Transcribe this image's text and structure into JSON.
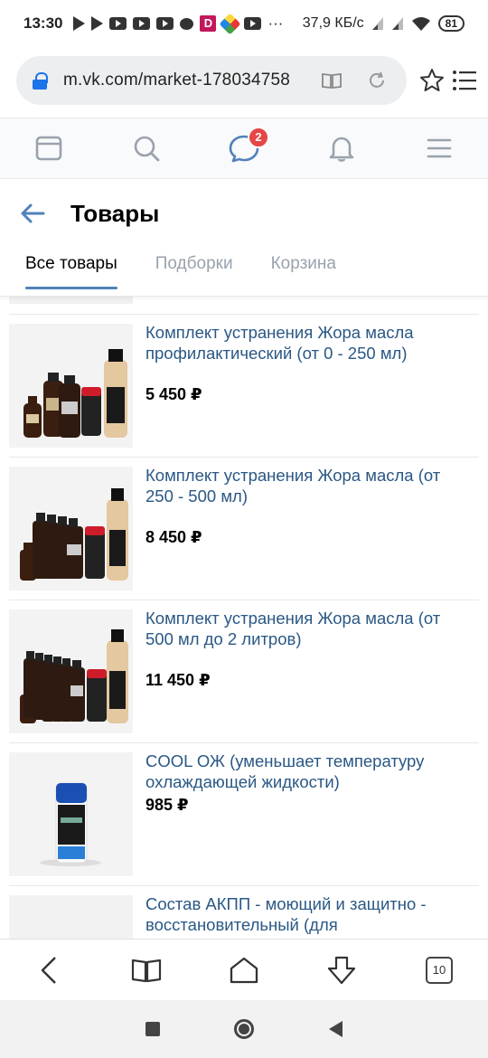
{
  "status_bar": {
    "time": "13:30",
    "speed": "37,9 КБ/с",
    "battery": "81",
    "dots": "···"
  },
  "browser": {
    "url": "m.vk.com/market-178034758",
    "tab_count": "10"
  },
  "nav": {
    "messages_badge": "2"
  },
  "page": {
    "title": "Товары"
  },
  "tabs": [
    {
      "label": "Все товары",
      "active": true
    },
    {
      "label": "Подборки",
      "active": false
    },
    {
      "label": "Корзина",
      "active": false
    }
  ],
  "products": [
    {
      "title": "Комплект устранения Жора масла профилактический (от 0 - 250 мл)",
      "price": "5 450 ₽",
      "bottles": 1
    },
    {
      "title": "Комплект устранения Жора масла (от 250 - 500 мл)",
      "price": "8 450 ₽",
      "bottles": 4
    },
    {
      "title": "Комплект устранения Жора масла (от 500 мл до 2 литров)",
      "price": "11 450 ₽",
      "bottles": 6
    },
    {
      "title": "COOL ОЖ (уменьшает температуру охлаждающей жидкости)",
      "price": "985 ₽",
      "bottles": 0
    },
    {
      "title": "Состав АКПП - моющий и защитно - восстановительный (для",
      "price": "",
      "bottles": 0
    }
  ],
  "colors": {
    "link": "#2a5885",
    "accent": "#5181b8",
    "badge": "#e64646",
    "inactive_tab": "#99a2ad"
  }
}
